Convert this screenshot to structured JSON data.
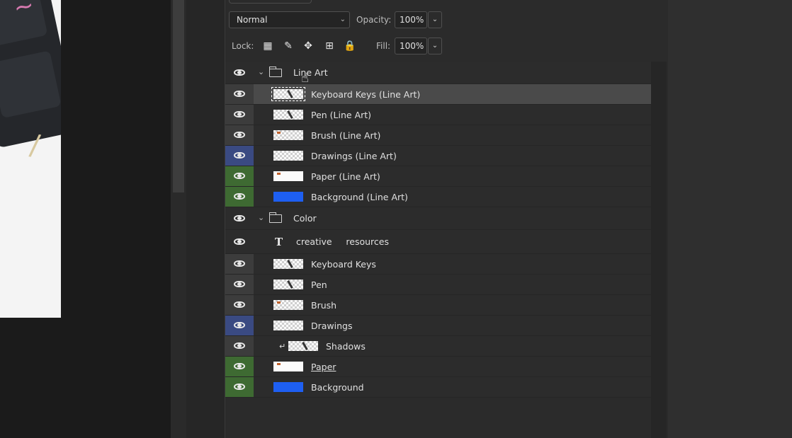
{
  "blend_mode": {
    "value": "Normal"
  },
  "opacity": {
    "label": "Opacity:",
    "value": "100%"
  },
  "lock": {
    "label": "Lock:",
    "icons": [
      "lock-transparent-pixels-icon",
      "lock-image-pixels-icon",
      "lock-position-icon",
      "lock-artboard-icon",
      "lock-all-icon"
    ]
  },
  "fill": {
    "label": "Fill:",
    "value": "100%"
  },
  "layers": [
    {
      "name": "Line Art",
      "kind": "group"
    },
    {
      "name": "Keyboard Keys (Line Art)",
      "kind": "layer",
      "selected": true
    },
    {
      "name": "Pen (Line Art)",
      "kind": "layer"
    },
    {
      "name": "Brush (Line Art)",
      "kind": "layer"
    },
    {
      "name": "Drawings (Line Art)",
      "kind": "layer",
      "color_tag": "blue"
    },
    {
      "name": "Paper (Line Art)",
      "kind": "layer",
      "color_tag": "green"
    },
    {
      "name": "Background (Line Art)",
      "kind": "layer",
      "color_tag": "green"
    },
    {
      "name": "Color",
      "kind": "group"
    },
    {
      "name": "creative     resources",
      "kind": "text"
    },
    {
      "name": "Keyboard Keys",
      "kind": "layer"
    },
    {
      "name": "Pen",
      "kind": "layer"
    },
    {
      "name": "Brush",
      "kind": "layer"
    },
    {
      "name": "Drawings",
      "kind": "layer",
      "color_tag": "blue"
    },
    {
      "name": "Shadows",
      "kind": "clipped-layer"
    },
    {
      "name": "Paper",
      "kind": "layer",
      "color_tag": "green"
    },
    {
      "name": "Background",
      "kind": "layer",
      "color_tag": "green"
    }
  ],
  "colors": {
    "blue_tag": "#3a4a82",
    "green_tag": "#3e6a32",
    "selected_row": "#4a4a4a"
  }
}
